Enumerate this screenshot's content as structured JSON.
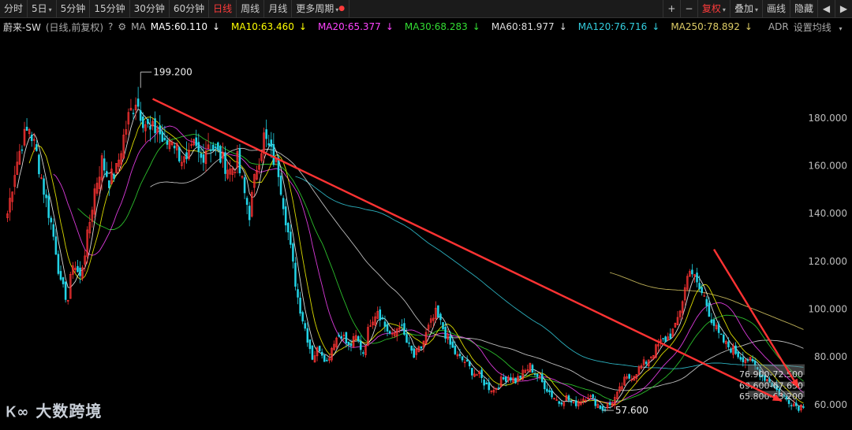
{
  "toolbar": {
    "left": [
      {
        "label": "分时",
        "name": "tab-intraday"
      },
      {
        "label": "5日",
        "name": "tab-5day",
        "caret": true
      },
      {
        "label": "5分钟",
        "name": "tab-5min"
      },
      {
        "label": "15分钟",
        "name": "tab-15min"
      },
      {
        "label": "30分钟",
        "name": "tab-30min"
      },
      {
        "label": "60分钟",
        "name": "tab-60min"
      },
      {
        "label": "日线",
        "name": "tab-daily",
        "active": true
      },
      {
        "label": "周线",
        "name": "tab-weekly"
      },
      {
        "label": "月线",
        "name": "tab-monthly"
      },
      {
        "label": "更多周期",
        "name": "tab-more-periods",
        "caret": true,
        "dot": true
      }
    ],
    "right": {
      "zoom_in": "+",
      "zoom_out": "−",
      "adjust": "复权",
      "overlay": "叠加",
      "draw": "画线",
      "hide": "隐藏",
      "prev": "◀",
      "next": "▶"
    }
  },
  "ma_bar": {
    "title": "蔚来-SW",
    "mode": "(日线,前复权)",
    "help": "?",
    "ma_label": "MA",
    "items": [
      {
        "text": "MA5:60.110",
        "arrow": "↓",
        "color": "#ffffff"
      },
      {
        "text": "MA10:63.460",
        "arrow": "↓",
        "color": "#ffff00"
      },
      {
        "text": "MA20:65.377",
        "arrow": "↓",
        "color": "#ff44ff"
      },
      {
        "text": "MA30:68.283",
        "arrow": "↓",
        "color": "#33dd33"
      },
      {
        "text": "MA60:81.977",
        "arrow": "↓",
        "color": "#dddddd"
      },
      {
        "text": "MA120:76.716",
        "arrow": "↓",
        "color": "#33ccdd"
      },
      {
        "text": "MA250:78.892",
        "arrow": "↓",
        "color": "#ddcc66"
      }
    ],
    "adr": "ADR",
    "settings": "设置均线"
  },
  "chart_data": {
    "type": "candlestick",
    "y_ticks": [
      "180.000",
      "160.000",
      "140.000",
      "120.000",
      "100.000",
      "80.000",
      "60.000"
    ],
    "ylim": [
      54,
      205
    ],
    "n_bars": 330,
    "annotations": {
      "high": "199.200",
      "low": "57.600"
    },
    "price_bands": [
      {
        "text": "76.900-72.500",
        "from": 72.5,
        "to": 76.9
      },
      {
        "text": "69.600-67.650",
        "from": 67.65,
        "to": 69.6
      },
      {
        "text": "65.800-63.200",
        "from": 63.2,
        "to": 65.8
      }
    ],
    "trendlines": [
      {
        "from": [
          60,
          188
        ],
        "to": [
          320,
          61.5
        ]
      },
      {
        "from": [
          292,
          125
        ],
        "to": [
          327,
          67
        ]
      }
    ],
    "close_path": [
      [
        0,
        140
      ],
      [
        3,
        158
      ],
      [
        6,
        170
      ],
      [
        9,
        176
      ],
      [
        12,
        165
      ],
      [
        15,
        150
      ],
      [
        18,
        136
      ],
      [
        20,
        125
      ],
      [
        22,
        110
      ],
      [
        25,
        104
      ],
      [
        27,
        120
      ],
      [
        30,
        113
      ],
      [
        33,
        130
      ],
      [
        36,
        150
      ],
      [
        39,
        162
      ],
      [
        42,
        154
      ],
      [
        45,
        158
      ],
      [
        48,
        172
      ],
      [
        50,
        180
      ],
      [
        53,
        188
      ],
      [
        56,
        180
      ],
      [
        59,
        174
      ],
      [
        62,
        176
      ],
      [
        65,
        168
      ],
      [
        68,
        172
      ],
      [
        71,
        165
      ],
      [
        74,
        160
      ],
      [
        77,
        168
      ],
      [
        80,
        163
      ],
      [
        83,
        170
      ],
      [
        86,
        166
      ],
      [
        89,
        162
      ],
      [
        92,
        158
      ],
      [
        95,
        162
      ],
      [
        98,
        148
      ],
      [
        100,
        140
      ],
      [
        103,
        160
      ],
      [
        106,
        172
      ],
      [
        109,
        165
      ],
      [
        112,
        158
      ],
      [
        114,
        145
      ],
      [
        116,
        132
      ],
      [
        118,
        118
      ],
      [
        120,
        105
      ],
      [
        122,
        96
      ],
      [
        124,
        88
      ],
      [
        126,
        80
      ],
      [
        129,
        84
      ],
      [
        132,
        78
      ],
      [
        135,
        87
      ],
      [
        138,
        90
      ],
      [
        141,
        84
      ],
      [
        144,
        88
      ],
      [
        147,
        82
      ],
      [
        150,
        95
      ],
      [
        153,
        100
      ],
      [
        156,
        93
      ],
      [
        159,
        88
      ],
      [
        162,
        94
      ],
      [
        165,
        86
      ],
      [
        168,
        80
      ],
      [
        171,
        84
      ],
      [
        174,
        92
      ],
      [
        177,
        98
      ],
      [
        180,
        92
      ],
      [
        183,
        85
      ],
      [
        186,
        80
      ],
      [
        189,
        78
      ],
      [
        192,
        74
      ],
      [
        195,
        72
      ],
      [
        198,
        68
      ],
      [
        201,
        66
      ],
      [
        204,
        70
      ],
      [
        207,
        72
      ],
      [
        210,
        70
      ],
      [
        213,
        73
      ],
      [
        216,
        76
      ],
      [
        219,
        72
      ],
      [
        222,
        68
      ],
      [
        225,
        64
      ],
      [
        228,
        61
      ],
      [
        231,
        63
      ],
      [
        234,
        60
      ],
      [
        237,
        62
      ],
      [
        240,
        64
      ],
      [
        243,
        61
      ],
      [
        246,
        58
      ],
      [
        249,
        60
      ],
      [
        252,
        64
      ],
      [
        255,
        70
      ],
      [
        258,
        72
      ],
      [
        261,
        75
      ],
      [
        264,
        78
      ],
      [
        267,
        82
      ],
      [
        270,
        86
      ],
      [
        273,
        88
      ],
      [
        276,
        92
      ],
      [
        279,
        104
      ],
      [
        282,
        118
      ],
      [
        285,
        110
      ],
      [
        288,
        105
      ],
      [
        291,
        96
      ],
      [
        294,
        89
      ],
      [
        297,
        85
      ],
      [
        300,
        83
      ],
      [
        303,
        80
      ],
      [
        306,
        79
      ],
      [
        309,
        76
      ],
      [
        312,
        72
      ],
      [
        315,
        70
      ],
      [
        318,
        66
      ],
      [
        321,
        63
      ],
      [
        324,
        61
      ],
      [
        327,
        59
      ],
      [
        329,
        60
      ]
    ]
  },
  "watermark": "大数跨境",
  "colors": {
    "up": "#ff3333",
    "down": "#22d3e6",
    "trend": "#ff3333",
    "bg": "#000000"
  }
}
